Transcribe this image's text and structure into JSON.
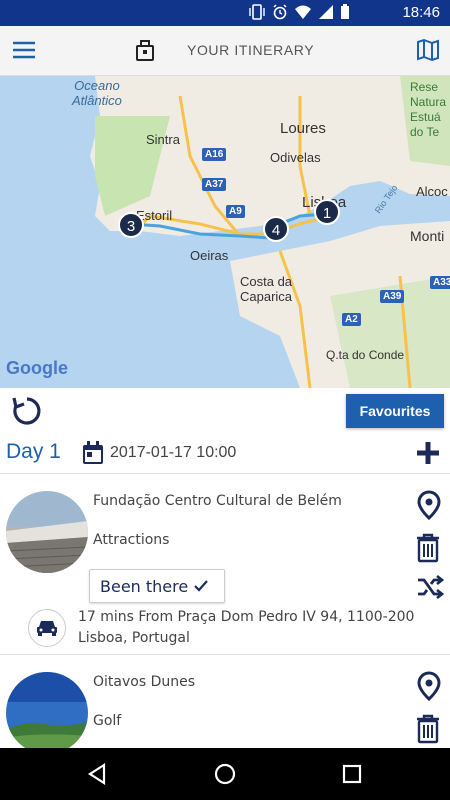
{
  "status": {
    "time": "18:46"
  },
  "header": {
    "title": "YOUR ITINERARY"
  },
  "map": {
    "labels": {
      "ocean": "Oceano\nAtlântico",
      "sintra": "Sintra",
      "loures": "Loures",
      "odivelas": "Odivelas",
      "lisboa": "Lisboa",
      "estoril": "Estoril",
      "oeiras": "Oeiras",
      "costa": "Costa da\nCaparica",
      "alcochete": "Alcoc",
      "montijo": "Monti",
      "reserva": "Rese\nNatura\nEstuá\ndo Te",
      "quinta": "Q.ta do Conde",
      "rio_tejo": "Rio Tejo",
      "google": "Google"
    },
    "roads": [
      "A16",
      "A37",
      "A9",
      "A2",
      "A39",
      "A33"
    ],
    "pins": [
      "1",
      "3",
      "4"
    ]
  },
  "toolbar": {
    "favourites_label": "Favourites"
  },
  "day": {
    "label": "Day 1",
    "date": "2017-01-17 10:00"
  },
  "items": [
    {
      "name": "Fundação Centro Cultural de Belém",
      "category": "Attractions",
      "been_there": "Been there",
      "travel": "17 mins From Praça Dom Pedro IV 94, 1100-200 Lisboa, Portugal"
    },
    {
      "name": "Oitavos Dunes",
      "category": "Golf"
    }
  ],
  "colors": {
    "status_bar": "#12358c",
    "accent": "#1d60ae",
    "dark_icon": "#1c2a5a"
  }
}
